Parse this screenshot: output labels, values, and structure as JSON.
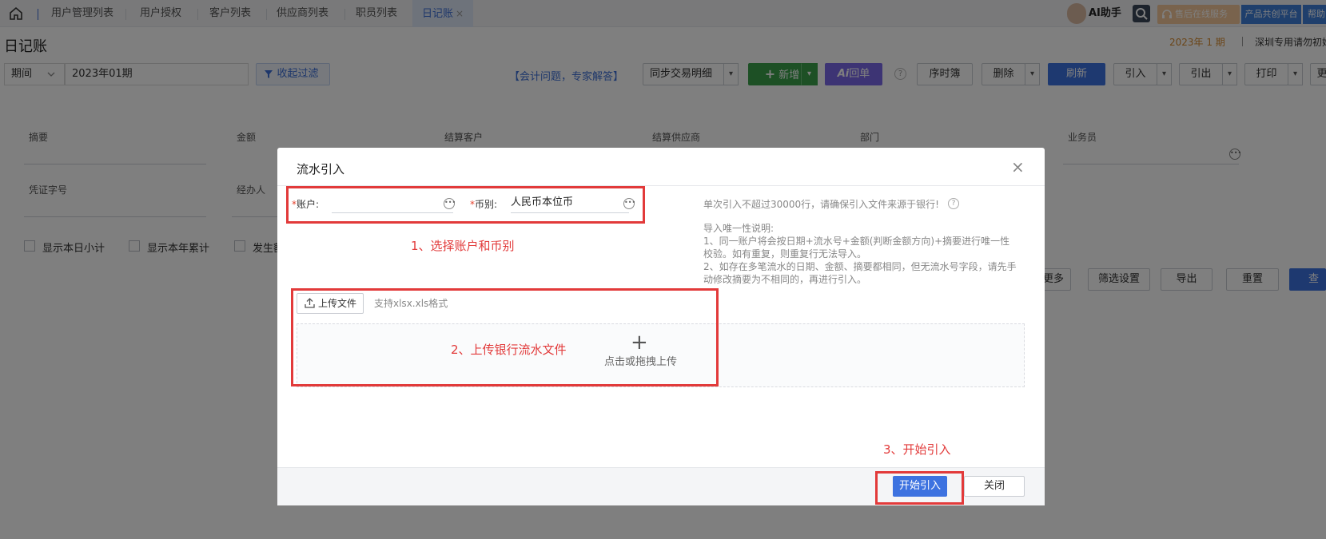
{
  "tabs": [
    {
      "label": "用户管理列表"
    },
    {
      "label": "用户授权"
    },
    {
      "label": "客户列表"
    },
    {
      "label": "供应商列表"
    },
    {
      "label": "职员列表"
    },
    {
      "label": "日记账",
      "close": "×"
    }
  ],
  "topright": {
    "ai_label": "AI助手",
    "service_label": "售后在线服务",
    "platform_label": "产品共创平台",
    "help_label": "帮助"
  },
  "page": {
    "title": "日记账",
    "period_badge": "2023年 1 期",
    "company": "深圳专用请勿初始"
  },
  "toolbar": {
    "period_select": "期间",
    "period_value": "2023年01期",
    "filter_btn": "收起过滤",
    "expert_link": "【会计问题，专家解答】",
    "sync_select": "同步交易明细",
    "add_btn": "新增",
    "ai_receipt_btn": "回单",
    "order_btn": "序时簿",
    "delete_btn": "删除",
    "refresh_btn": "刷新",
    "import_btn": "引入",
    "export_btn": "引出",
    "print_btn": "打印",
    "more_btn": "更"
  },
  "filters": {
    "labels": [
      "摘要",
      "金额",
      "结算客户",
      "结算供应商",
      "部门",
      "业务员",
      "凭证字号",
      "经办人"
    ],
    "checkboxes": [
      "显示本日小计",
      "显示本年累计",
      "发生额"
    ],
    "more_btn": "更多",
    "settings_btn": "筛选设置",
    "export_btn": "导出",
    "reset_btn": "重置",
    "query_btn": "查询"
  },
  "modal": {
    "title": "流水引入",
    "account_label": "账户:",
    "currency_label": "币别:",
    "currency_value": "人民币本位币",
    "limit_hint": "单次引入不超过30000行，请确保引入文件来源于银行!",
    "unique_title": "导入唯一性说明:",
    "unique_1": "1、同一账户将会按日期+流水号+金额(判断金额方向)+摘要进行唯一性校验。如有重复，则重复行无法导入。",
    "unique_2": "2、如存在多笔流水的日期、金额、摘要都相同，但无流水号字段，请先手动修改摘要为不相同的，再进行引入。",
    "upload_btn": "上传文件",
    "upload_hint": "支持xlsx.xls格式",
    "drop_hint": "点击或拖拽上传",
    "start_btn": "开始引入",
    "close_btn": "关闭"
  },
  "annotations": {
    "step1": "1、选择账户和币别",
    "step2": "2、上传银行流水文件",
    "step3": "3、开始引入"
  },
  "colors": {
    "accent": "#3d72e0",
    "annotation": "#e23a3a",
    "add_green": "#3aa14b",
    "ai_purple": "#7b68e8"
  }
}
